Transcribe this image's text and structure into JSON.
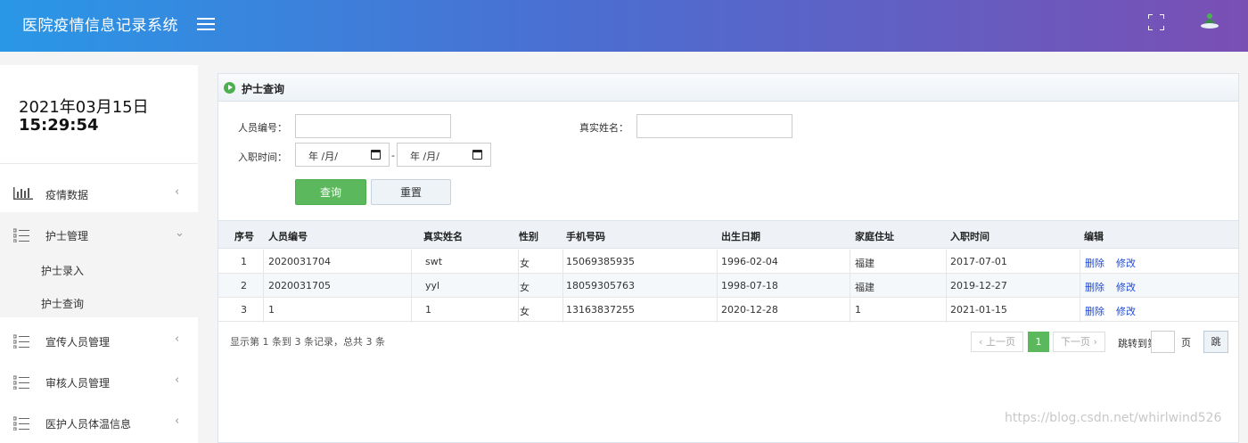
{
  "header": {
    "title": "医院疫情信息记录系统"
  },
  "clock": {
    "date": "2021年03月15日",
    "time": "15:29:54"
  },
  "sidebar": {
    "items": [
      {
        "label": "疫情数据",
        "chevron": "‹"
      },
      {
        "label": "护士管理",
        "chevron": "⌄"
      },
      {
        "label": "宣传人员管理",
        "chevron": "‹"
      },
      {
        "label": "审核人员管理",
        "chevron": "‹"
      },
      {
        "label": "医护人员体温信息",
        "chevron": "‹"
      }
    ],
    "subitems": [
      "护士录入",
      "护士查询"
    ]
  },
  "panel": {
    "title": "护士查询"
  },
  "form": {
    "staff_id_label": "人员编号：",
    "real_name_label": "真实姓名：",
    "hire_date_label": "入职时间：",
    "date_placeholder": "年 /月/",
    "range_sep": "-",
    "query_label": "查询",
    "reset_label": "重置"
  },
  "table": {
    "headers": [
      "序号",
      "人员编号",
      "真实姓名",
      "性别",
      "手机号码",
      "出生日期",
      "家庭住址",
      "入职时间",
      "编辑"
    ],
    "rows": [
      [
        "1",
        "2020031704",
        "swt",
        "女",
        "15069385935",
        "1996-02-04",
        "福建",
        "2017-07-01"
      ],
      [
        "2",
        "2020031705",
        "yyl",
        "女",
        "18059305763",
        "1998-07-18",
        "福建",
        "2019-12-27"
      ],
      [
        "3",
        "1",
        "1",
        "女",
        "13163837255",
        "2020-12-28",
        "1",
        "2021-01-15"
      ]
    ],
    "delete_label": "删除",
    "edit_label": "修改"
  },
  "pager": {
    "info": "显示第 1 条到 3 条记录，总共 3 条",
    "prev": "‹ 上一页",
    "current": "1",
    "next": "下一页 ›",
    "goto_label": "跳转到第",
    "page_unit": "页",
    "goto_button": "跳"
  },
  "watermark": "https://blog.csdn.net/whirlwind526",
  "colors": {
    "accent": "#5cb85c",
    "link": "#1e4bd8",
    "header_start": "#2a97e6",
    "header_end": "#7a4fb4"
  }
}
